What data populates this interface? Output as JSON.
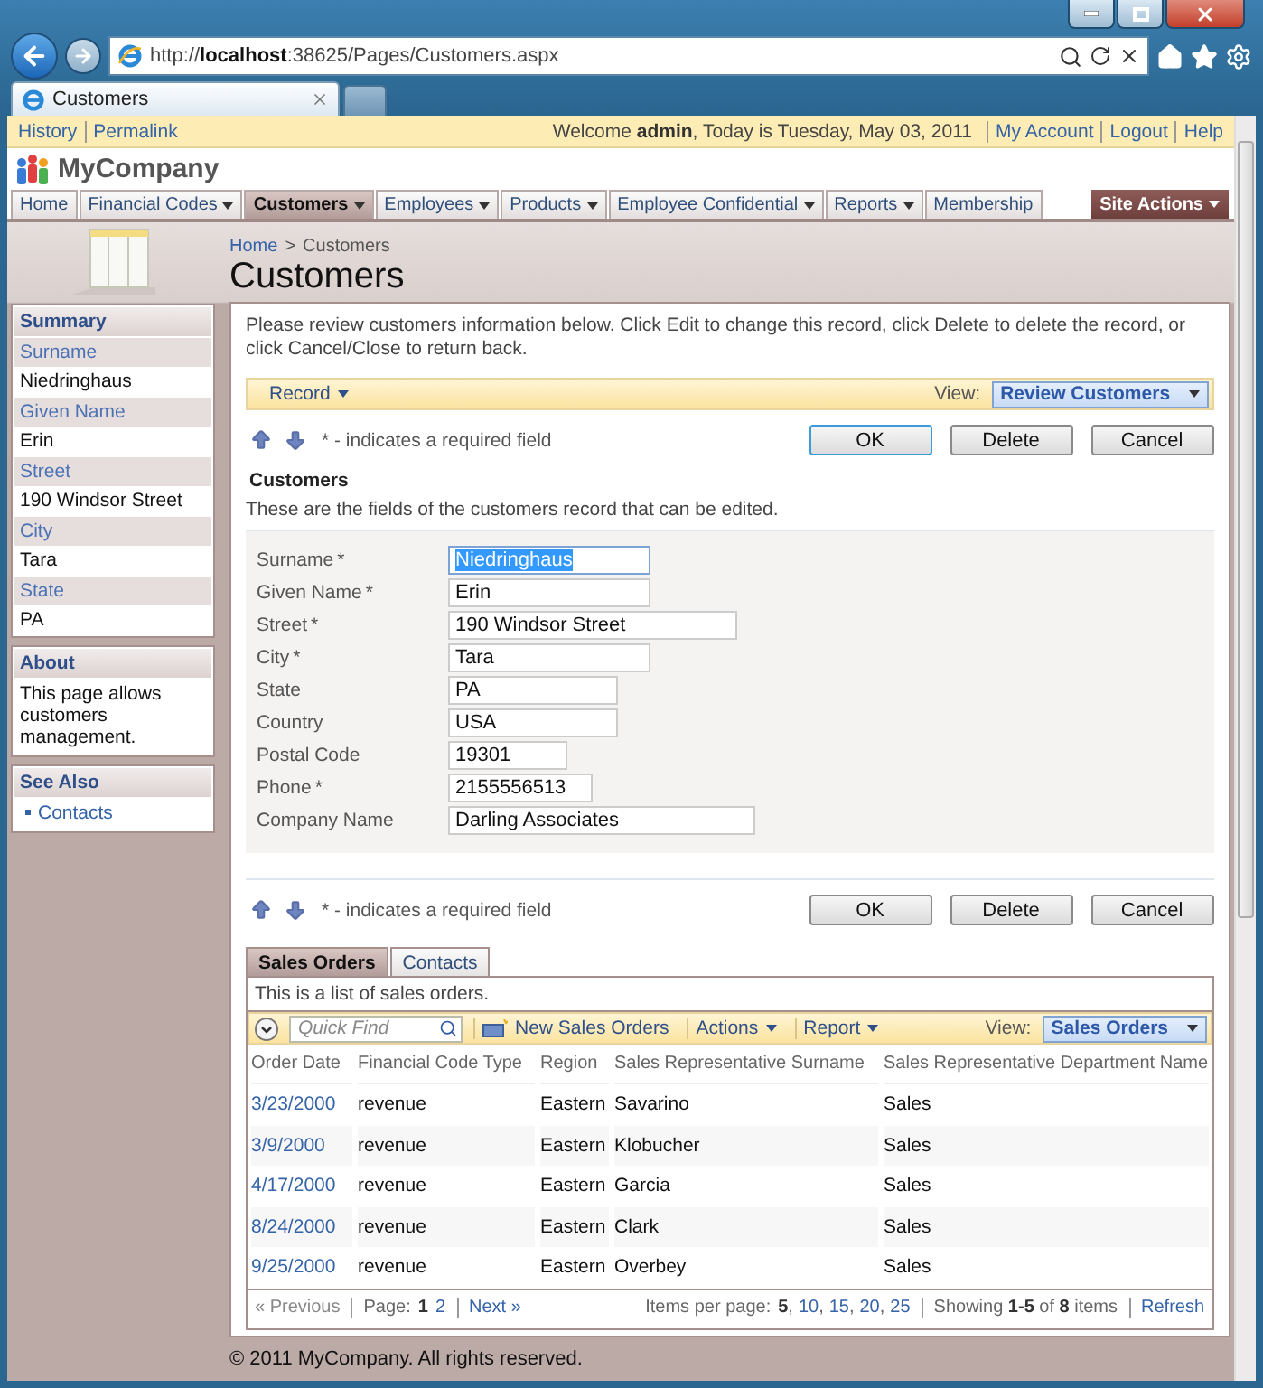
{
  "browser": {
    "url": "http://**localhost**:38625/Pages/Customers.aspx",
    "tab_title": "Customers"
  },
  "top_bar": {
    "links_left": [
      "History",
      "Permalink"
    ],
    "welcome": "Welcome **admin**, Today is Tuesday, May 03, 2011",
    "links_right": [
      "My Account",
      "Logout",
      "Help"
    ]
  },
  "logo": "MyCompany",
  "menu": [
    {
      "label": "Home",
      "has_menu": false,
      "selected": false
    },
    {
      "label": "Financial Codes",
      "has_menu": true,
      "selected": false
    },
    {
      "label": "Customers",
      "has_menu": true,
      "selected": true
    },
    {
      "label": "Employees",
      "has_menu": true,
      "selected": false
    },
    {
      "label": "Products",
      "has_menu": true,
      "selected": false
    },
    {
      "label": "Employee Confidential",
      "has_menu": true,
      "selected": false
    },
    {
      "label": "Reports",
      "has_menu": true,
      "selected": false
    },
    {
      "label": "Membership",
      "has_menu": false,
      "selected": false
    }
  ],
  "site_actions": "Site Actions",
  "breadcrumb": {
    "items": [
      "Home",
      "Customers"
    ],
    "separator": ">"
  },
  "page_title": "Customers",
  "sidebar": {
    "summary": {
      "title": "Summary",
      "fields": [
        {
          "label": "Surname",
          "value": "Niedringhaus"
        },
        {
          "label": "Given Name",
          "value": "Erin"
        },
        {
          "label": "Street",
          "value": "190 Windsor Street"
        },
        {
          "label": "City",
          "value": "Tara"
        },
        {
          "label": "State",
          "value": "PA"
        }
      ]
    },
    "about": {
      "title": "About",
      "text": "This page allows customers management."
    },
    "see_also": {
      "title": "See Also",
      "links": [
        "Contacts"
      ]
    }
  },
  "form": {
    "description": "Please review customers information below. Click Edit to change this record, click Delete to delete the record, or click Cancel/Close to return back.",
    "toolbar": {
      "record": "Record",
      "view_label": "View:",
      "view": "Review Customers"
    },
    "required_note": "* - indicates a required field",
    "required_mark": "*",
    "buttons": [
      {
        "label": "OK",
        "default": true
      },
      {
        "label": "Delete",
        "default": false
      },
      {
        "label": "Cancel",
        "default": false
      }
    ],
    "section_title": "Customers",
    "section_text": "These are the fields of the customers record that can be edited.",
    "fields": [
      {
        "label": "Surname",
        "required": true,
        "value": "Niedringhaus",
        "selected": true
      },
      {
        "label": "Given Name",
        "required": true,
        "value": "Erin",
        "selected": false
      },
      {
        "label": "Street",
        "required": true,
        "value": "190 Windsor Street",
        "selected": false
      },
      {
        "label": "City",
        "required": true,
        "value": "Tara",
        "selected": false
      },
      {
        "label": "State",
        "required": false,
        "value": "PA",
        "selected": false
      },
      {
        "label": "Country",
        "required": false,
        "value": "USA",
        "selected": false
      },
      {
        "label": "Postal Code",
        "required": false,
        "value": "19301",
        "selected": false
      },
      {
        "label": "Phone",
        "required": true,
        "value": "2155556513",
        "selected": false
      },
      {
        "label": "Company Name",
        "required": false,
        "value": "Darling Associates",
        "selected": false
      }
    ],
    "bottom_note": "* - indicates a required field",
    "bottom_buttons": [
      {
        "label": "OK",
        "default": false
      },
      {
        "label": "Delete",
        "default": false
      },
      {
        "label": "Cancel",
        "default": false
      }
    ]
  },
  "details": {
    "tabs": [
      {
        "label": "Sales Orders",
        "selected": true
      },
      {
        "label": "Contacts",
        "selected": false
      }
    ],
    "description": "This is a list of sales orders.",
    "toolbar": {
      "quick_find_placeholder": "Quick Find",
      "new": "New Sales Orders",
      "actions": "Actions",
      "report": "Report",
      "view_label": "View:",
      "view": "Sales Orders"
    },
    "columns": [
      "Order Date",
      "Financial Code Type",
      "Region",
      "Sales Representative Surname",
      "Sales Representative Department Name"
    ],
    "rows": [
      [
        "3/23/2000",
        "revenue",
        "Eastern",
        "Savarino",
        "Sales"
      ],
      [
        "3/9/2000",
        "revenue",
        "Eastern",
        "Klobucher",
        "Sales"
      ],
      [
        "4/17/2000",
        "revenue",
        "Eastern",
        "Garcia",
        "Sales"
      ],
      [
        "8/24/2000",
        "revenue",
        "Eastern",
        "Clark",
        "Sales"
      ],
      [
        "9/25/2000",
        "revenue",
        "Eastern",
        "Overbey",
        "Sales"
      ]
    ],
    "pager": {
      "previous": {
        "label": "« Previous",
        "disabled": true
      },
      "page_label": "Page:",
      "pages": [
        {
          "label": "1",
          "selected": true
        },
        {
          "label": "2",
          "selected": false
        }
      ],
      "next": {
        "label": "Next »",
        "disabled": false
      },
      "items_per_page_label": "Items per page:",
      "separator": ",",
      "page_sizes": [
        {
          "label": "5",
          "selected": true
        },
        {
          "label": "10",
          "selected": false
        },
        {
          "label": "15",
          "selected": false
        },
        {
          "label": "20",
          "selected": false
        },
        {
          "label": "25",
          "selected": false
        }
      ],
      "showing": "Showing **1-5** of **8** items",
      "refresh": "Refresh"
    }
  },
  "footer": "© 2011 MyCompany. All rights reserved."
}
